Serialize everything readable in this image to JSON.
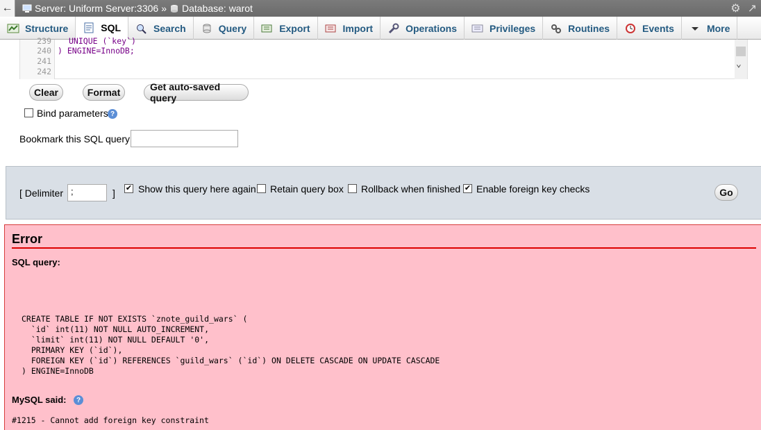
{
  "topbar": {
    "server": "Server: Uniform Server:3306",
    "separator": "»",
    "database": "Database: warot"
  },
  "tabs": [
    {
      "label": "Structure",
      "icon": "structure-icon"
    },
    {
      "label": "SQL",
      "icon": "sql-icon",
      "active": true
    },
    {
      "label": "Search",
      "icon": "search-icon"
    },
    {
      "label": "Query",
      "icon": "query-icon"
    },
    {
      "label": "Export",
      "icon": "export-icon"
    },
    {
      "label": "Import",
      "icon": "import-icon"
    },
    {
      "label": "Operations",
      "icon": "wrench-icon"
    },
    {
      "label": "Privileges",
      "icon": "privileges-icon"
    },
    {
      "label": "Routines",
      "icon": "routines-icon"
    },
    {
      "label": "Events",
      "icon": "clock-icon"
    },
    {
      "label": "More",
      "icon": "chevron-down-icon"
    }
  ],
  "editor": {
    "lines": [
      {
        "num": "239",
        "text": "UNIQUE (`key`)"
      },
      {
        "num": "240",
        "text": ") ENGINE=InnoDB;"
      },
      {
        "num": "241",
        "text": ""
      },
      {
        "num": "242",
        "text": ""
      }
    ]
  },
  "buttons": {
    "clear": "Clear",
    "format": "Format",
    "autosaved": "Get auto-saved query",
    "go": "Go"
  },
  "bind_parameters": {
    "label": "Bind parameters",
    "checked": false
  },
  "bookmark": {
    "label": "Bookmark this SQL query:",
    "value": ""
  },
  "options": {
    "delimiter_open": "[ Delimiter",
    "delimiter_value": ";",
    "delimiter_close": "]",
    "show_query": {
      "label": "Show this query here again",
      "checked": true
    },
    "retain_box": {
      "label": "Retain query box",
      "checked": false
    },
    "rollback": {
      "label": "Rollback when finished",
      "checked": false
    },
    "foreign_keys": {
      "label": "Enable foreign key checks",
      "checked": true
    }
  },
  "error": {
    "title": "Error",
    "sql_query_label": "SQL query:",
    "query_lines": [
      "CREATE TABLE IF NOT EXISTS `znote_guild_wars` (",
      "  `id` int(11) NOT NULL AUTO_INCREMENT,",
      "  `limit` int(11) NOT NULL DEFAULT '0',",
      "  PRIMARY KEY (`id`),",
      "  FOREIGN KEY (`id`) REFERENCES `guild_wars` (`id`) ON DELETE CASCADE ON UPDATE CASCADE",
      ") ENGINE=InnoDB"
    ],
    "mysql_said_label": "MySQL said:",
    "message": "#1215 - Cannot add foreign key constraint"
  }
}
